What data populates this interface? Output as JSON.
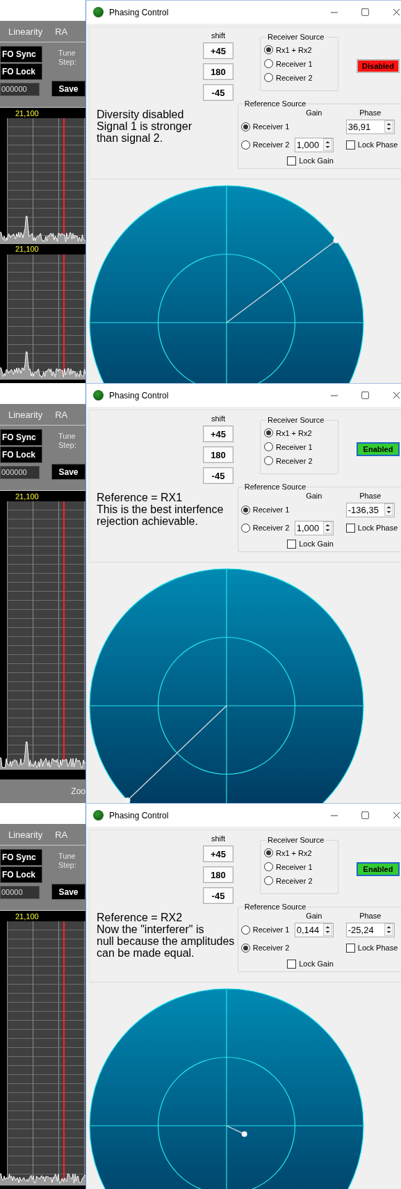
{
  "panels": [
    {
      "background_app": {
        "menu": [
          "Linearity",
          "RA"
        ],
        "vfo_buttons": [
          "FO Sync",
          "FO Lock"
        ],
        "tune_step_label": "Tune Step:",
        "frequency_value": "000000",
        "save_button": "Save",
        "spectra": [
          {
            "frequency_label": "21,100",
            "peak": true
          },
          {
            "frequency_label": "21,100",
            "peak": true
          }
        ]
      },
      "window": {
        "title": "Phasing Control",
        "shift_label": "shift",
        "shift_buttons": [
          "+45",
          "180",
          "-45"
        ],
        "receiver_source": {
          "title": "Receiver Source",
          "options": [
            {
              "label": "Rx1 + Rx2",
              "selected": true
            },
            {
              "label": "Receiver 1",
              "selected": false
            },
            {
              "label": "Receiver 2",
              "selected": false
            }
          ]
        },
        "status_button": {
          "label": "Disabled",
          "enabled": false
        },
        "note": "Diversity disabled\nSignal 1 is stronger\nthan signal 2.",
        "reference_source": {
          "title": "Reference Source",
          "gain_label": "Gain",
          "phase_label": "Phase",
          "options": [
            {
              "label": "Receiver 1",
              "selected": true
            },
            {
              "label": "Receiver 2",
              "selected": false,
              "gain_value": "1,000"
            }
          ],
          "phase_value": "36,91",
          "lock_phase": {
            "label": "Lock Phase",
            "checked": false
          },
          "lock_gain": {
            "label": "Lock Gain",
            "checked": false
          }
        }
      }
    },
    {
      "background_app": {
        "menu": [
          "Linearity",
          "RA"
        ],
        "vfo_buttons": [
          "FO Sync",
          "FO Lock"
        ],
        "tune_step_label": "Tune Step:",
        "frequency_value": "000000",
        "save_button": "Save",
        "spectra": [
          {
            "frequency_label": "21,100",
            "peak": true
          }
        ],
        "footer_label": "Zoo"
      },
      "window": {
        "title": "Phasing Control",
        "shift_label": "shift",
        "shift_buttons": [
          "+45",
          "180",
          "-45"
        ],
        "receiver_source": {
          "title": "Receiver Source",
          "options": [
            {
              "label": "Rx1 + Rx2",
              "selected": true
            },
            {
              "label": "Receiver 1",
              "selected": false
            },
            {
              "label": "Receiver 2",
              "selected": false
            }
          ]
        },
        "status_button": {
          "label": "Enabled",
          "enabled": true
        },
        "note": "Reference = RX1\nThis is the best interfence\nrejection achievable.",
        "reference_source": {
          "title": "Reference Source",
          "gain_label": "Gain",
          "phase_label": "Phase",
          "options": [
            {
              "label": "Receiver 1",
              "selected": true
            },
            {
              "label": "Receiver 2",
              "selected": false,
              "gain_value": "1,000"
            }
          ],
          "phase_value": "-136,35",
          "lock_phase": {
            "label": "Lock Phase",
            "checked": false
          },
          "lock_gain": {
            "label": "Lock Gain",
            "checked": false
          }
        }
      }
    },
    {
      "background_app": {
        "menu": [
          "Linearity",
          "RA"
        ],
        "vfo_buttons": [
          "FO Sync",
          "FO Lock"
        ],
        "tune_step_label": "Tune Step:",
        "frequency_value": "00000",
        "save_button": "Save",
        "spectra": [
          {
            "frequency_label": "21,100",
            "peak": false
          }
        ]
      },
      "window": {
        "title": "Phasing Control",
        "shift_label": "shift",
        "shift_buttons": [
          "+45",
          "180",
          "-45"
        ],
        "receiver_source": {
          "title": "Receiver Source",
          "options": [
            {
              "label": "Rx1 + Rx2",
              "selected": true
            },
            {
              "label": "Receiver 1",
              "selected": false
            },
            {
              "label": "Receiver 2",
              "selected": false
            }
          ]
        },
        "status_button": {
          "label": "Enabled",
          "enabled": true
        },
        "note": "Reference = RX2\nNow the \"interferer\" is\nnull because the amplitudes\ncan be made equal.",
        "reference_source": {
          "title": "Reference Source",
          "gain_label": "Gain",
          "phase_label": "Phase",
          "options": [
            {
              "label": "Receiver 1",
              "selected": false,
              "gain_value": "0,144"
            },
            {
              "label": "Receiver 2",
              "selected": true
            }
          ],
          "phase_value": "-25,24",
          "lock_phase": {
            "label": "Lock Phase",
            "checked": false
          },
          "lock_gain": {
            "label": "Lock Gain",
            "checked": false
          }
        }
      }
    }
  ]
}
